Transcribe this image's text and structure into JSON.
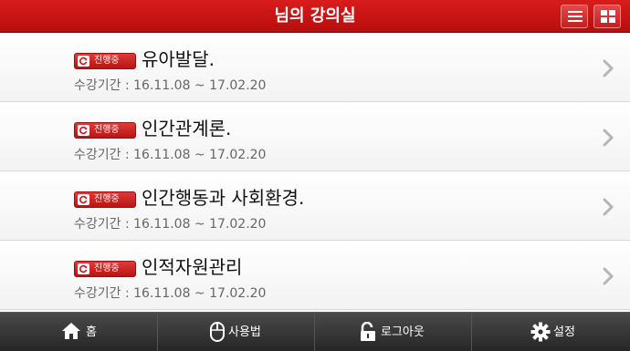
{
  "header": {
    "title": "님의 강의실"
  },
  "badge_label": "진행중",
  "courses": [
    {
      "title": "유아발달.",
      "period": "수강기간 : 16.11.08 ~ 17.02.20"
    },
    {
      "title": "인간관계론.",
      "period": "수강기간 : 16.11.08 ~ 17.02.20"
    },
    {
      "title": "인간행동과 사회환경.",
      "period": "수강기간 : 16.11.08 ~ 17.02.20"
    },
    {
      "title": "인적자원관리",
      "period": "수강기간 : 16.11.08 ~ 17.02.20"
    }
  ],
  "footer": {
    "home": "홈",
    "usage": "사용법",
    "logout": "로그아웃",
    "settings": "설정"
  },
  "colors": {
    "brand_red": "#c8141a",
    "footer_dark": "#333333"
  },
  "icons": [
    "list-icon",
    "grid-icon",
    "refresh-icon",
    "chevron-right-icon",
    "home-icon",
    "mouse-icon",
    "unlock-icon",
    "gear-icon"
  ]
}
